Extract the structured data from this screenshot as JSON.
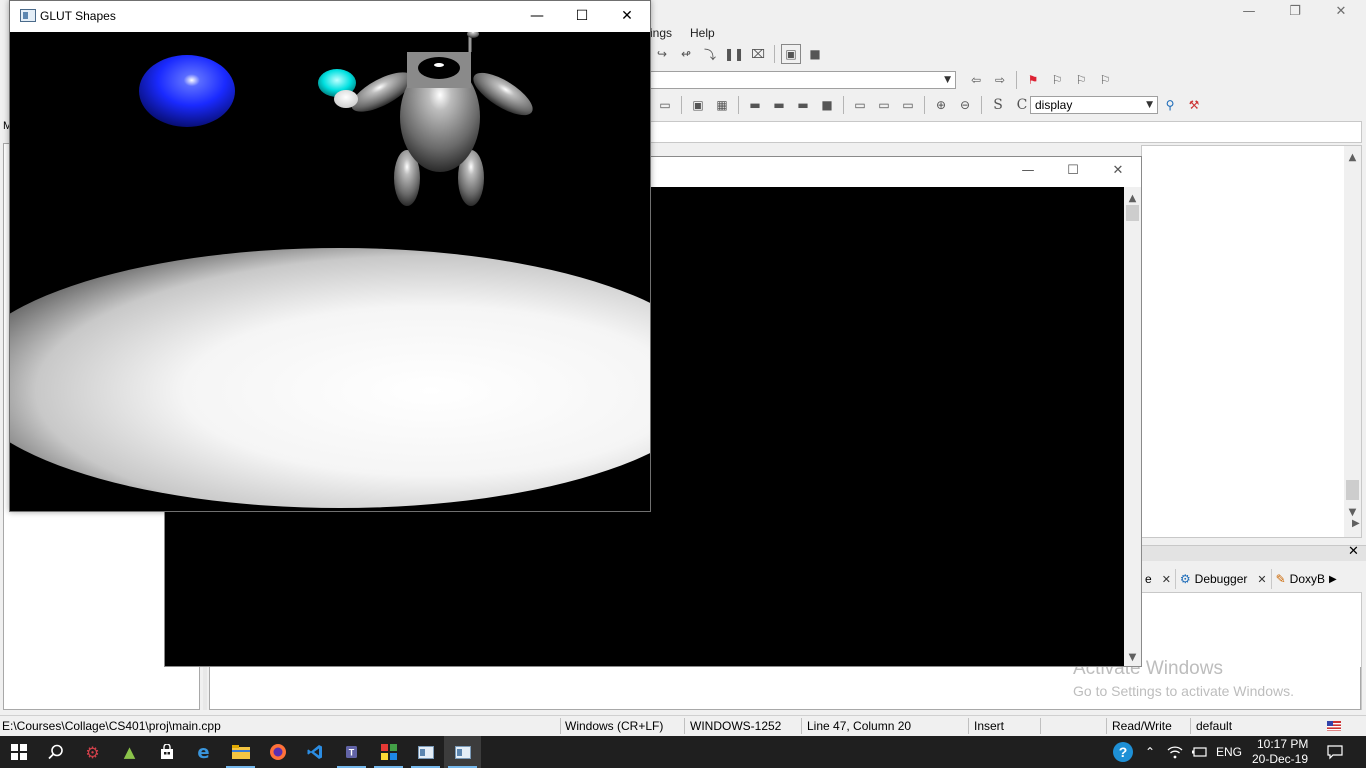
{
  "ide": {
    "menu": {
      "settings_partial": "ings",
      "help": "Help"
    },
    "function_combo": "display",
    "logs_tabs": [
      {
        "label": "e"
      },
      {
        "label": "Debugger"
      },
      {
        "label": "DoxyB"
      }
    ],
    "left_partial_label": "M",
    "watermark": {
      "title": "Activate Windows",
      "subtitle": "Go to Settings to activate Windows."
    },
    "statusbar": {
      "file_path": "E:\\Courses\\Collage\\CS401\\proj\\main.cpp",
      "line_endings": "Windows (CR+LF)",
      "encoding": "WINDOWS-1252",
      "position": "Line 47, Column 20",
      "mode": "Insert",
      "access": "Read/Write",
      "profile": "default"
    }
  },
  "glut_window": {
    "title": "GLUT Shapes"
  },
  "taskbar": {
    "language": "ENG",
    "time": "10:17 PM",
    "date": "20-Dec-19"
  },
  "colors": {
    "taskbar_bg": "#1f1f1f",
    "active_indicator": "#76b9ed",
    "sphere_blue": "#1a2aff",
    "sphere_cyan": "#00e0e0"
  }
}
